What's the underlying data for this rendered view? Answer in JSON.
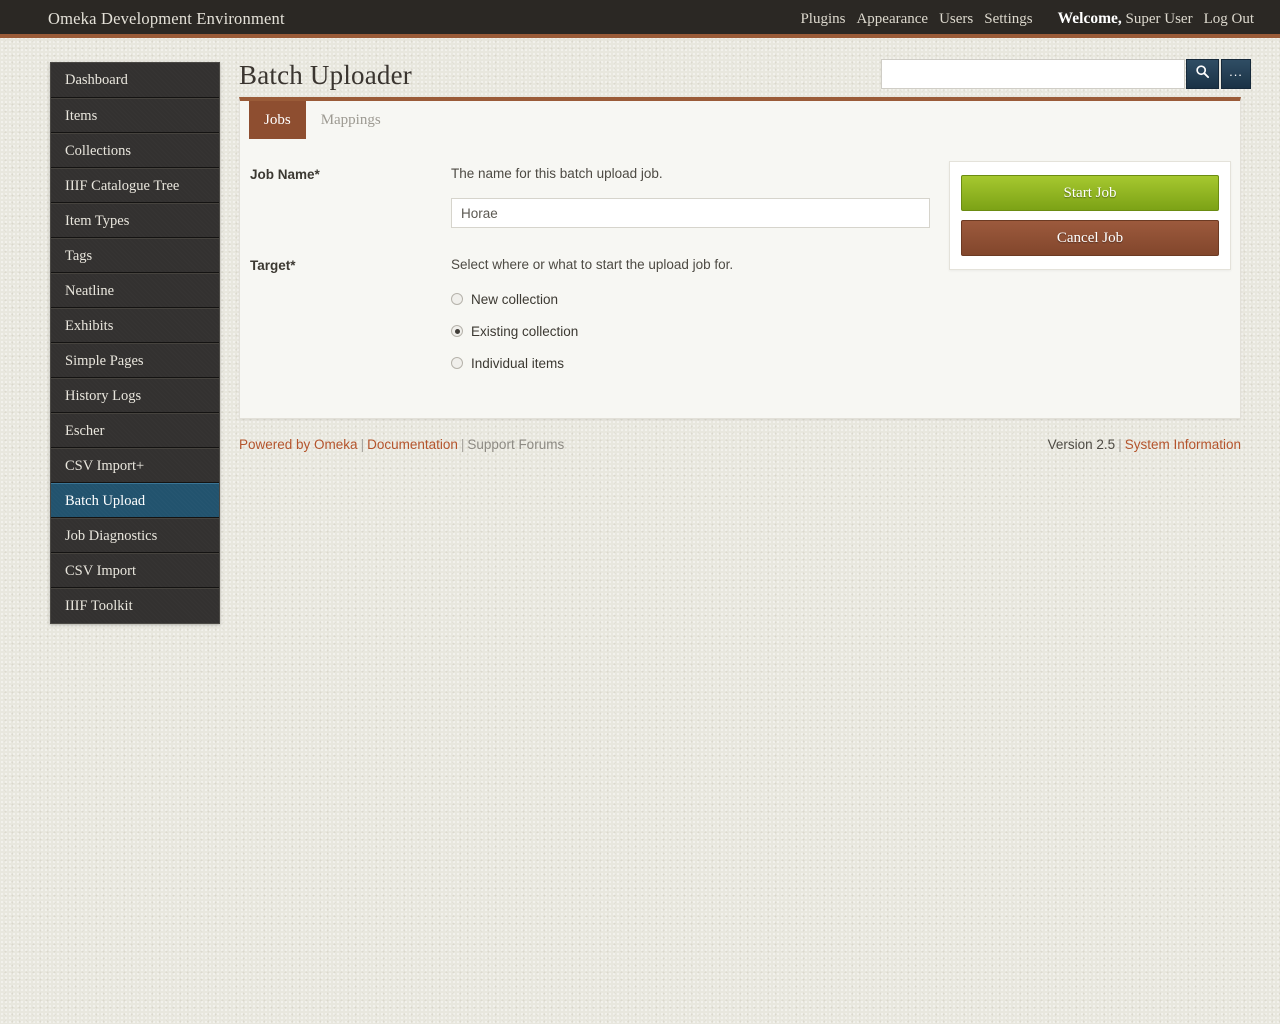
{
  "topbar": {
    "site_title": "Omeka Development Environment",
    "nav": [
      {
        "label": "Plugins",
        "name": "plugins"
      },
      {
        "label": "Appearance",
        "name": "appearance"
      },
      {
        "label": "Users",
        "name": "users"
      },
      {
        "label": "Settings",
        "name": "settings"
      }
    ],
    "welcome_word": "Welcome,",
    "user_name": "Super User",
    "logout_label": "Log Out"
  },
  "sidebar": {
    "items": [
      {
        "label": "Dashboard",
        "active": false
      },
      {
        "label": "Items",
        "active": false
      },
      {
        "label": "Collections",
        "active": false
      },
      {
        "label": "IIIF Catalogue Tree",
        "active": false
      },
      {
        "label": "Item Types",
        "active": false
      },
      {
        "label": "Tags",
        "active": false
      },
      {
        "label": "Neatline",
        "active": false
      },
      {
        "label": "Exhibits",
        "active": false
      },
      {
        "label": "Simple Pages",
        "active": false
      },
      {
        "label": "History Logs",
        "active": false
      },
      {
        "label": "Escher",
        "active": false
      },
      {
        "label": "CSV Import+",
        "active": false
      },
      {
        "label": "Batch Upload",
        "active": true
      },
      {
        "label": "Job Diagnostics",
        "active": false
      },
      {
        "label": "CSV Import",
        "active": false
      },
      {
        "label": "IIIF Toolkit",
        "active": false
      }
    ]
  },
  "page": {
    "title": "Batch Uploader"
  },
  "search": {
    "value": "",
    "placeholder": "",
    "go_icon": "search-icon",
    "advanced_label": "..."
  },
  "tabs": [
    {
      "label": "Jobs",
      "active": true
    },
    {
      "label": "Mappings",
      "active": false
    }
  ],
  "form": {
    "job_name": {
      "label": "Job Name*",
      "description": "The name for this batch upload job.",
      "value": "Horae",
      "placeholder": "Horae"
    },
    "target": {
      "label": "Target*",
      "description": "Select where or what to start the upload job for.",
      "options": [
        {
          "label": "New collection",
          "checked": false
        },
        {
          "label": "Existing collection",
          "checked": true
        },
        {
          "label": "Individual items",
          "checked": false
        }
      ]
    }
  },
  "actions": {
    "start_label": "Start Job",
    "cancel_label": "Cancel Job"
  },
  "footer": {
    "powered_by": "Powered by Omeka",
    "documentation": "Documentation",
    "support_forums": "Support Forums",
    "separator": "|",
    "version": "Version 2.5",
    "system_information": "System Information"
  },
  "colors": {
    "accent_brown": "#9a5b38",
    "tab_active": "#8e4e30",
    "sidebar_active": "#22536e",
    "start_green": "#a6c82f",
    "cancel_brown": "#9c5a3d",
    "link_rust": "#b4542c",
    "page_bg": "#e8e7de"
  }
}
